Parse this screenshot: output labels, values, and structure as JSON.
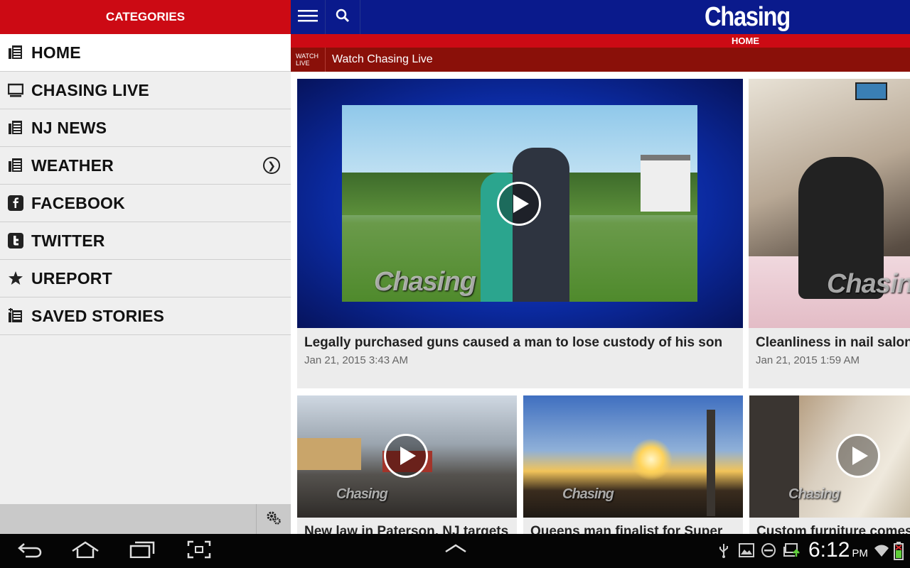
{
  "sidebar": {
    "header": "CATEGORIES",
    "items": [
      {
        "label": "HOME",
        "icon": "newspaper-icon"
      },
      {
        "label": "CHASING LIVE",
        "icon": "monitor-icon"
      },
      {
        "label": "NJ NEWS",
        "icon": "newspaper-icon"
      },
      {
        "label": "WEATHER",
        "icon": "newspaper-icon"
      },
      {
        "label": "FACEBOOK",
        "icon": "facebook-icon"
      },
      {
        "label": "TWITTER",
        "icon": "twitter-icon"
      },
      {
        "label": "UREPORT",
        "icon": "star-icon"
      },
      {
        "label": "SAVED STORIES",
        "icon": "saved-icon"
      }
    ]
  },
  "header": {
    "logo": "Chasing",
    "section": "HOME"
  },
  "live": {
    "tag_line1": "WATCH",
    "tag_line2": "LIVE",
    "text": "Watch Chasing Live"
  },
  "stories": [
    {
      "title": "Legally purchased guns caused a man to lose custody of his son",
      "date": "Jan 21, 2015 3:43 AM",
      "watermark": "Chasing"
    },
    {
      "title": "Cleanliness in nail salons",
      "date": "Jan 21, 2015 1:59 AM",
      "watermark": "Chasing"
    },
    {
      "title": "New law in Paterson, NJ targets",
      "date": "",
      "watermark": "Chasing"
    },
    {
      "title": "Queens man finalist for Super",
      "date": "",
      "watermark": "Chasing"
    },
    {
      "title": "Custom furniture comes",
      "date": "",
      "watermark": "Chasing"
    }
  ],
  "status": {
    "time": "6:12",
    "ampm": "PM"
  },
  "colors": {
    "brand_red": "#cc0a14",
    "brand_blue": "#0a1a8c",
    "live_bar": "#8a1009"
  }
}
